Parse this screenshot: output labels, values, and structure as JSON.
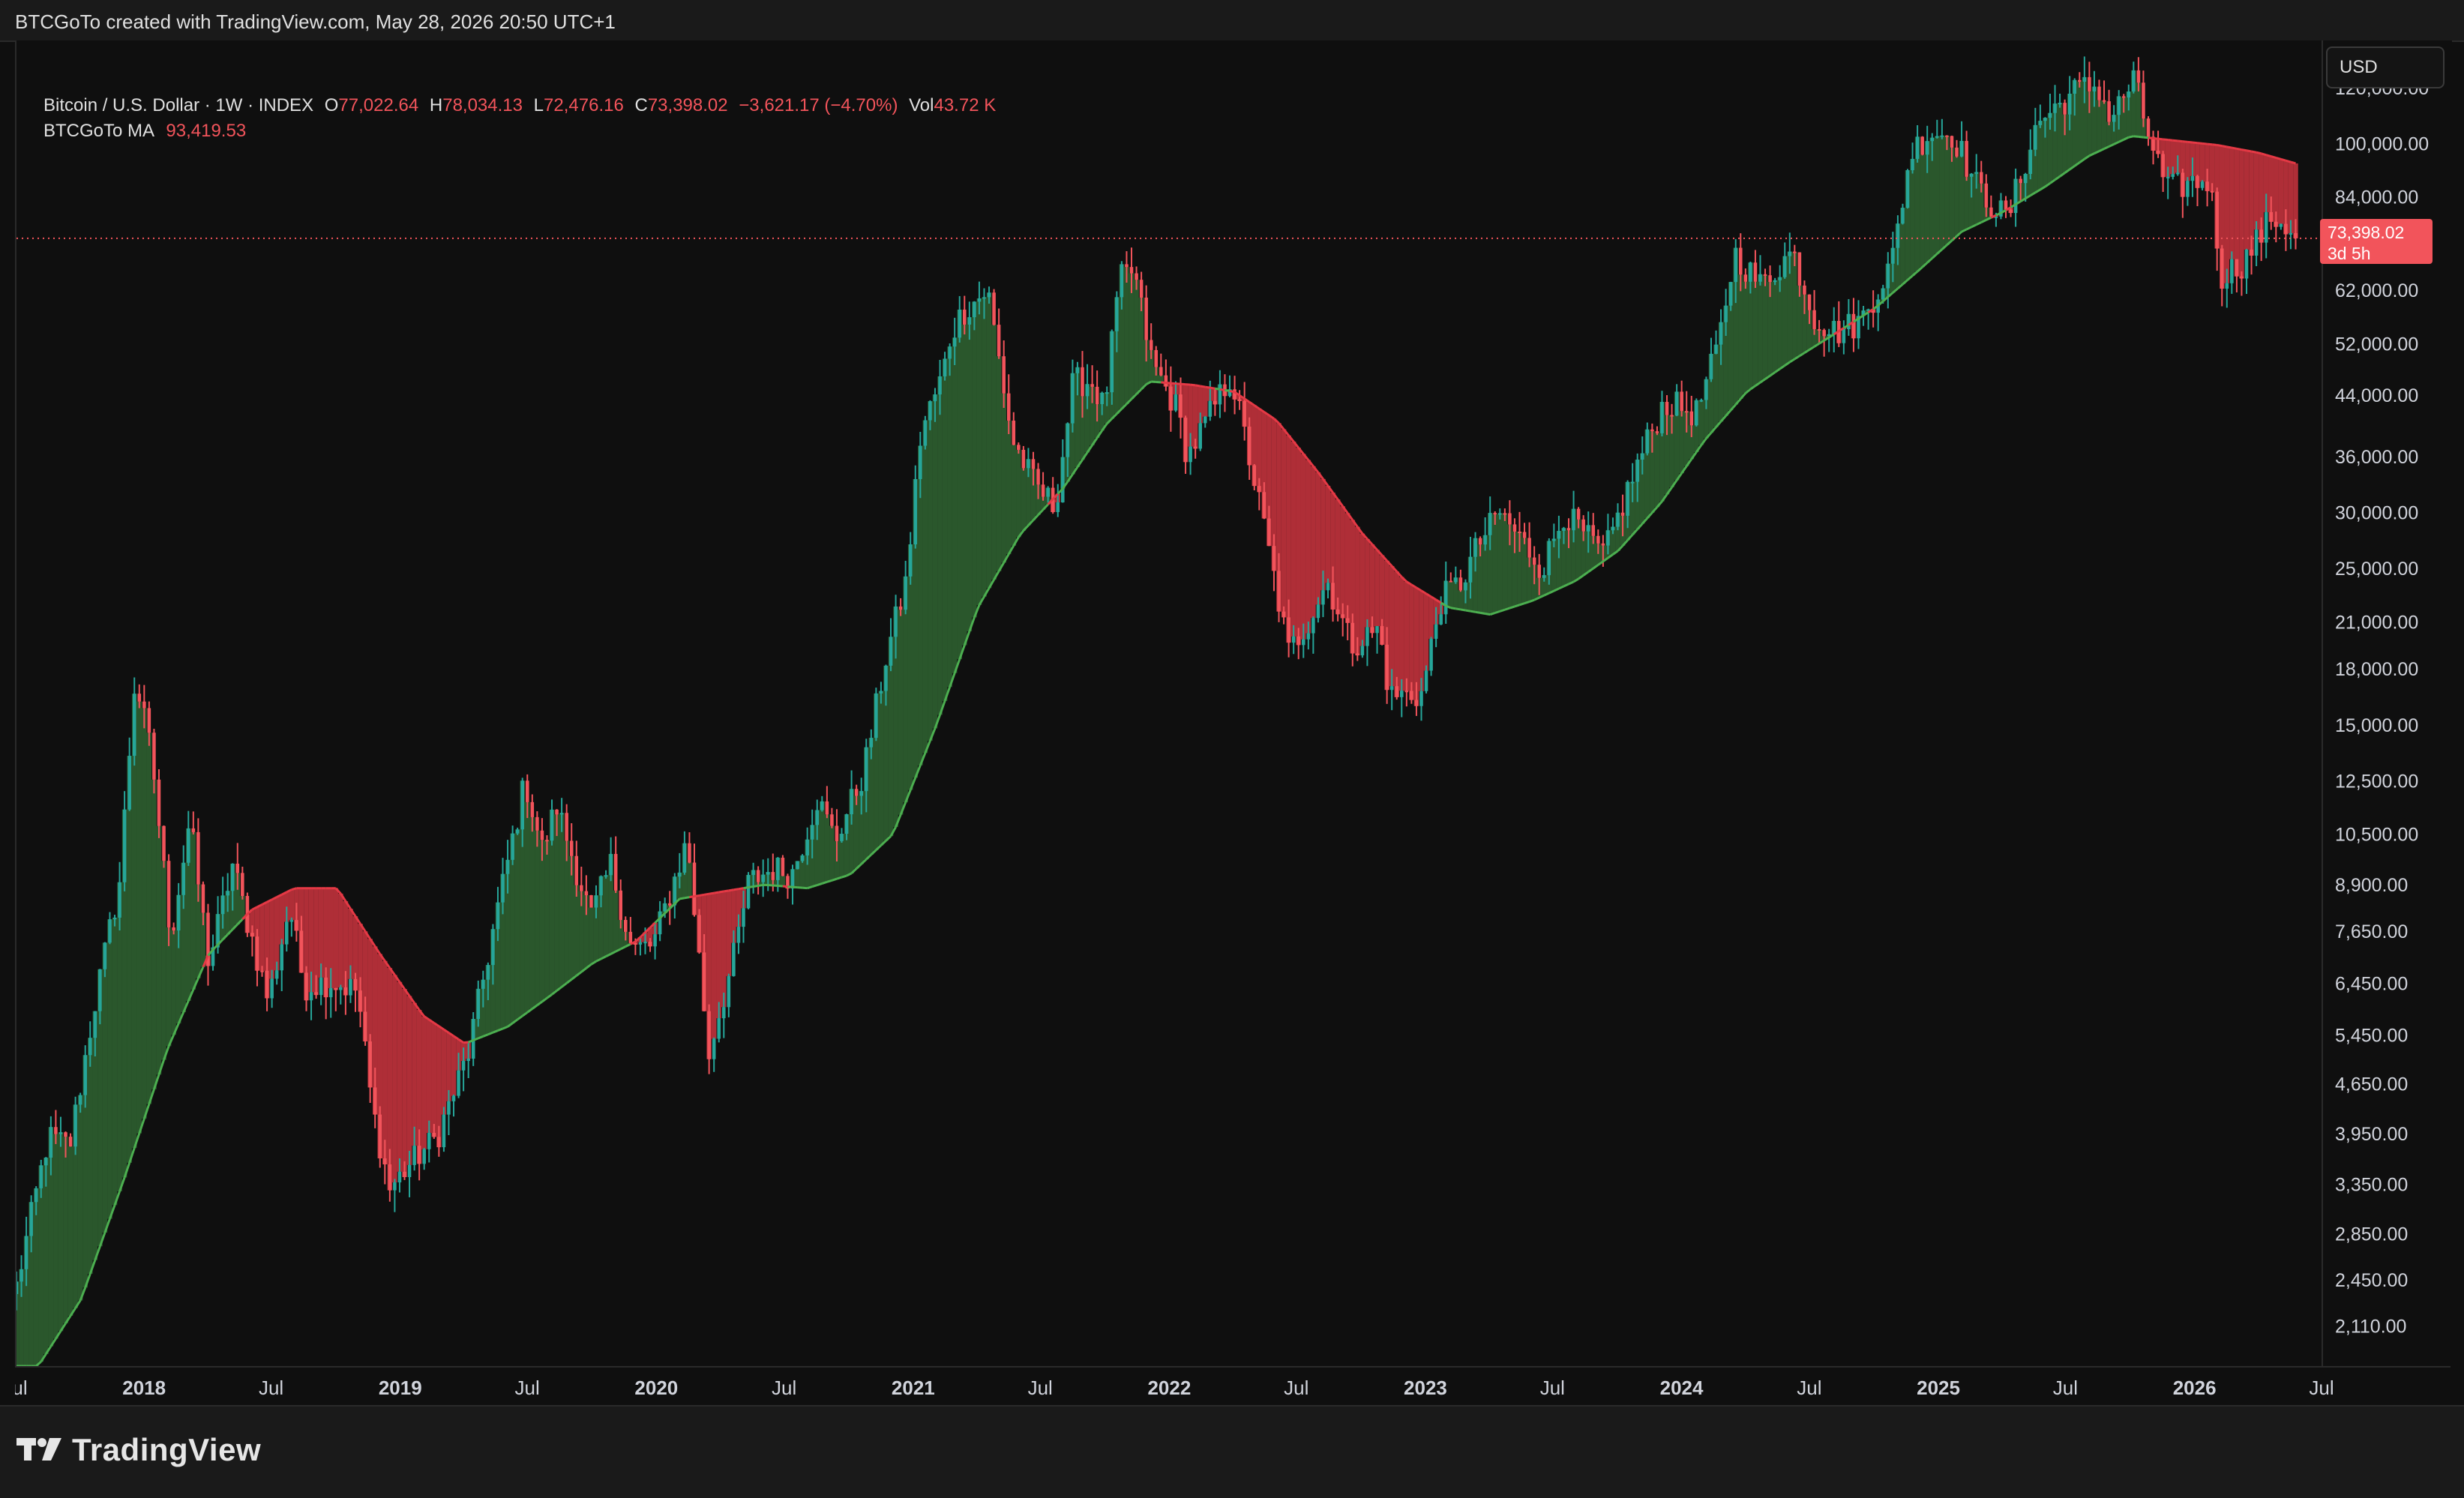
{
  "header": {
    "attribution": "BTCGoTo created with TradingView.com, May 28, 2026 20:50 UTC+1"
  },
  "legend": {
    "symbol": "Bitcoin / U.S. Dollar · 1W · INDEX",
    "open_label": "O",
    "open": "77,022.64",
    "high_label": "H",
    "high": "78,034.13",
    "low_label": "L",
    "low": "72,476.16",
    "close_label": "C",
    "close": "73,398.02",
    "change": "−3,621.17 (−4.70%)",
    "vol_label": "Vol",
    "vol": "43.72 K",
    "indicator_name": "BTCGoTo MA",
    "indicator_value": "93,419.53"
  },
  "currency_button": "USD",
  "last_price_tag": {
    "price": "73,398.02",
    "countdown": "3d 5h"
  },
  "brand": {
    "name": "TradingView"
  },
  "icons": {
    "replay": "lightning-icon",
    "logo": "tradingview-logo-icon"
  },
  "colors": {
    "up": "#26a69a",
    "down": "#f2545b",
    "ma_up": "#4caf50",
    "ma_down": "#e53945",
    "background": "#0f0f0f"
  },
  "chart_data": {
    "type": "candlestick",
    "interval": "1W",
    "y_scale": "log",
    "ylim": [
      1850,
      140000
    ],
    "y_ticks": [
      120000,
      100000,
      84000,
      62000,
      52000,
      44000,
      36000,
      30000,
      25000,
      21000,
      18000,
      15000,
      12500,
      10500,
      8900,
      7650,
      6450,
      5450,
      4650,
      3950,
      3350,
      2850,
      2450,
      2110
    ],
    "y_tick_labels": [
      "120,000.00",
      "100,000.00",
      "84,000.00",
      "62,000.00",
      "52,000.00",
      "44,000.00",
      "36,000.00",
      "30,000.00",
      "25,000.00",
      "21,000.00",
      "18,000.00",
      "15,000.00",
      "12,500.00",
      "10,500.00",
      "8,900.00",
      "7,650.00",
      "6,450.00",
      "5,450.00",
      "4,650.00",
      "3,950.00",
      "3,350.00",
      "2,850.00",
      "2,450.00",
      "2,110.00"
    ],
    "x_range": [
      "2017-07-01",
      "2026-07-01"
    ],
    "x_ticks": [
      {
        "date": "2017-07-01",
        "label": "Jul",
        "major": false
      },
      {
        "date": "2018-01-01",
        "label": "2018",
        "major": true
      },
      {
        "date": "2018-07-01",
        "label": "Jul",
        "major": false
      },
      {
        "date": "2019-01-01",
        "label": "2019",
        "major": true
      },
      {
        "date": "2019-07-01",
        "label": "Jul",
        "major": false
      },
      {
        "date": "2020-01-01",
        "label": "2020",
        "major": true
      },
      {
        "date": "2020-07-01",
        "label": "Jul",
        "major": false
      },
      {
        "date": "2021-01-01",
        "label": "2021",
        "major": true
      },
      {
        "date": "2021-07-01",
        "label": "Jul",
        "major": false
      },
      {
        "date": "2022-01-01",
        "label": "2022",
        "major": true
      },
      {
        "date": "2022-07-01",
        "label": "Jul",
        "major": false
      },
      {
        "date": "2023-01-01",
        "label": "2023",
        "major": true
      },
      {
        "date": "2023-07-01",
        "label": "Jul",
        "major": false
      },
      {
        "date": "2024-01-01",
        "label": "2024",
        "major": true
      },
      {
        "date": "2024-07-01",
        "label": "Jul",
        "major": false
      },
      {
        "date": "2025-01-01",
        "label": "2025",
        "major": true
      },
      {
        "date": "2025-07-01",
        "label": "Jul",
        "major": false
      },
      {
        "date": "2026-01-01",
        "label": "2026",
        "major": true
      },
      {
        "date": "2026-07-01",
        "label": "Jul",
        "major": false
      }
    ],
    "last_price": 73398.02,
    "price_anchors": [
      [
        "2017-07-01",
        2400
      ],
      [
        "2017-08-15",
        3900
      ],
      [
        "2017-09-15",
        3800
      ],
      [
        "2017-10-20",
        6000
      ],
      [
        "2017-11-25",
        9000
      ],
      [
        "2017-12-17",
        17500
      ],
      [
        "2018-01-10",
        13500
      ],
      [
        "2018-02-06",
        7500
      ],
      [
        "2018-03-05",
        11000
      ],
      [
        "2018-04-01",
        6900
      ],
      [
        "2018-05-05",
        9500
      ],
      [
        "2018-06-25",
        6100
      ],
      [
        "2018-07-25",
        8300
      ],
      [
        "2018-08-15",
        6400
      ],
      [
        "2018-09-20",
        6500
      ],
      [
        "2018-10-30",
        6300
      ],
      [
        "2018-11-20",
        4300
      ],
      [
        "2018-12-15",
        3300
      ],
      [
        "2019-01-15",
        3600
      ],
      [
        "2019-02-20",
        3900
      ],
      [
        "2019-04-05",
        5100
      ],
      [
        "2019-05-15",
        8000
      ],
      [
        "2019-06-26",
        12500
      ],
      [
        "2019-07-20",
        10000
      ],
      [
        "2019-08-10",
        11500
      ],
      [
        "2019-09-28",
        8000
      ],
      [
        "2019-10-26",
        9500
      ],
      [
        "2019-11-25",
        7200
      ],
      [
        "2019-12-25",
        7300
      ],
      [
        "2020-02-12",
        10300
      ],
      [
        "2020-03-14",
        5100
      ],
      [
        "2020-03-16",
        5300
      ],
      [
        "2020-04-15",
        6800
      ],
      [
        "2020-05-10",
        9000
      ],
      [
        "2020-06-15",
        9400
      ],
      [
        "2020-07-10",
        9200
      ],
      [
        "2020-08-15",
        11800
      ],
      [
        "2020-09-10",
        10300
      ],
      [
        "2020-10-20",
        12800
      ],
      [
        "2020-11-20",
        18500
      ],
      [
        "2020-12-20",
        24000
      ],
      [
        "2021-01-10",
        39000
      ],
      [
        "2021-02-10",
        47000
      ],
      [
        "2021-02-22",
        54000
      ],
      [
        "2021-03-12",
        58000
      ],
      [
        "2021-04-15",
        62000
      ],
      [
        "2021-05-20",
        38000
      ],
      [
        "2021-06-20",
        33000
      ],
      [
        "2021-07-20",
        30500
      ],
      [
        "2021-08-15",
        46000
      ],
      [
        "2021-09-10",
        46000
      ],
      [
        "2021-09-28",
        42000
      ],
      [
        "2021-10-20",
        64000
      ],
      [
        "2021-11-09",
        66000
      ],
      [
        "2021-12-05",
        49000
      ],
      [
        "2022-01-10",
        42000
      ],
      [
        "2022-01-25",
        36000
      ],
      [
        "2022-03-28",
        47000
      ],
      [
        "2022-05-10",
        30000
      ],
      [
        "2022-06-18",
        19000
      ],
      [
        "2022-07-15",
        21000
      ],
      [
        "2022-08-12",
        24000
      ],
      [
        "2022-09-15",
        19500
      ],
      [
        "2022-10-25",
        20500
      ],
      [
        "2022-11-09",
        16500
      ],
      [
        "2022-12-25",
        16600
      ],
      [
        "2023-01-20",
        22500
      ],
      [
        "2023-02-20",
        24000
      ],
      [
        "2023-03-15",
        27000
      ],
      [
        "2023-04-15",
        30000
      ],
      [
        "2023-06-15",
        25000
      ],
      [
        "2023-07-15",
        30000
      ],
      [
        "2023-09-10",
        26000
      ],
      [
        "2023-10-25",
        34500
      ],
      [
        "2023-12-05",
        43000
      ],
      [
        "2024-01-20",
        41500
      ],
      [
        "2024-02-20",
        51500
      ],
      [
        "2024-03-14",
        70000
      ],
      [
        "2024-04-20",
        63000
      ],
      [
        "2024-06-05",
        70500
      ],
      [
        "2024-07-05",
        57000
      ],
      [
        "2024-08-05",
        54000
      ],
      [
        "2024-09-10",
        56000
      ],
      [
        "2024-10-25",
        68000
      ],
      [
        "2024-11-20",
        97000
      ],
      [
        "2024-12-17",
        104000
      ],
      [
        "2025-01-20",
        103000
      ],
      [
        "2025-02-25",
        86000
      ],
      [
        "2025-04-07",
        78000
      ],
      [
        "2025-05-20",
        107000
      ],
      [
        "2025-07-14",
        119000
      ],
      [
        "2025-08-14",
        121000
      ],
      [
        "2025-09-01",
        108000
      ],
      [
        "2025-10-06",
        124000
      ],
      [
        "2025-10-15",
        111000
      ],
      [
        "2025-11-20",
        86000
      ],
      [
        "2025-12-25",
        88000
      ],
      [
        "2026-01-20",
        89000
      ],
      [
        "2026-02-06",
        65000
      ],
      [
        "2026-03-10",
        68000
      ],
      [
        "2026-04-20",
        79000
      ],
      [
        "2026-05-10",
        76500
      ],
      [
        "2026-05-28",
        73398
      ]
    ],
    "ma_anchors": [
      [
        "2017-08-01",
        1850
      ],
      [
        "2017-10-01",
        2300
      ],
      [
        "2017-12-01",
        3400
      ],
      [
        "2018-02-01",
        5200
      ],
      [
        "2018-04-01",
        7100
      ],
      [
        "2018-06-01",
        8200
      ],
      [
        "2018-08-01",
        8800
      ],
      [
        "2018-10-01",
        8800
      ],
      [
        "2018-12-01",
        7100
      ],
      [
        "2019-02-01",
        5800
      ],
      [
        "2019-04-01",
        5300
      ],
      [
        "2019-06-01",
        5600
      ],
      [
        "2019-08-01",
        6200
      ],
      [
        "2019-10-01",
        6900
      ],
      [
        "2019-12-01",
        7400
      ],
      [
        "2020-02-01",
        8500
      ],
      [
        "2020-04-01",
        8700
      ],
      [
        "2020-06-01",
        8900
      ],
      [
        "2020-08-01",
        8800
      ],
      [
        "2020-10-01",
        9200
      ],
      [
        "2020-12-01",
        10500
      ],
      [
        "2021-02-01",
        15000
      ],
      [
        "2021-04-01",
        22000
      ],
      [
        "2021-06-01",
        28000
      ],
      [
        "2021-08-01",
        32500
      ],
      [
        "2021-10-01",
        40000
      ],
      [
        "2021-12-01",
        46000
      ],
      [
        "2022-02-01",
        45500
      ],
      [
        "2022-04-01",
        44500
      ],
      [
        "2022-06-01",
        40500
      ],
      [
        "2022-08-01",
        34000
      ],
      [
        "2022-10-01",
        28000
      ],
      [
        "2022-12-01",
        24000
      ],
      [
        "2023-02-01",
        22000
      ],
      [
        "2023-04-01",
        21500
      ],
      [
        "2023-06-01",
        22500
      ],
      [
        "2023-08-01",
        24000
      ],
      [
        "2023-10-01",
        26500
      ],
      [
        "2023-12-01",
        31000
      ],
      [
        "2024-02-01",
        38000
      ],
      [
        "2024-04-01",
        44500
      ],
      [
        "2024-06-01",
        49000
      ],
      [
        "2024-08-01",
        53500
      ],
      [
        "2024-10-01",
        58500
      ],
      [
        "2024-12-01",
        66000
      ],
      [
        "2025-02-01",
        75000
      ],
      [
        "2025-04-01",
        80000
      ],
      [
        "2025-06-01",
        87000
      ],
      [
        "2025-08-01",
        96000
      ],
      [
        "2025-10-01",
        102500
      ],
      [
        "2025-12-01",
        101000
      ],
      [
        "2026-02-01",
        99500
      ],
      [
        "2026-04-01",
        97000
      ],
      [
        "2026-05-28",
        93419.53
      ]
    ]
  }
}
